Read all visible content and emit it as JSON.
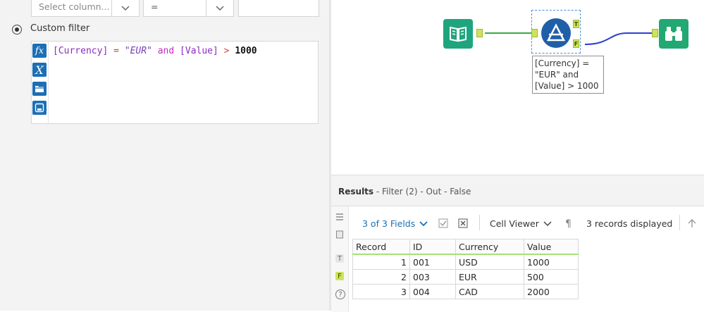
{
  "filter_panel": {
    "column_select_placeholder": "Select column...",
    "operator_value": "=",
    "custom_filter_label": "Custom filter",
    "expression": {
      "field1": "[Currency]",
      "op1": " = ",
      "string": "\"EUR\"",
      "kw": " and ",
      "field2": "[Value]",
      "op2": " > ",
      "number": "1000"
    },
    "gutter_icons": [
      "fx-function-icon",
      "x-variable-icon",
      "folder-open-icon",
      "save-icon"
    ]
  },
  "canvas": {
    "anchor_true": "T",
    "anchor_false": "F",
    "annotation": [
      "[Currency] =",
      "\"EUR\" and",
      "[Value] > 1000"
    ],
    "colors": {
      "input_tool": "#1fa57e",
      "filter_tool": "#1f5fa8",
      "browse_tool": "#21a873",
      "connection_true": "#39a845",
      "connection_false": "#2e3fd1"
    }
  },
  "results": {
    "title": "Results",
    "subtitle": " - Filter (2) - Out - False",
    "fields_label": "3 of 3 Fields",
    "cell_viewer_label": "Cell Viewer",
    "records_label": "3 records displayed",
    "columns": [
      "Record",
      "ID",
      "Currency",
      "Value"
    ],
    "rows": [
      [
        "1",
        "001",
        "USD",
        "1000"
      ],
      [
        "2",
        "003",
        "EUR",
        "500"
      ],
      [
        "3",
        "004",
        "CAD",
        "2000"
      ]
    ]
  }
}
